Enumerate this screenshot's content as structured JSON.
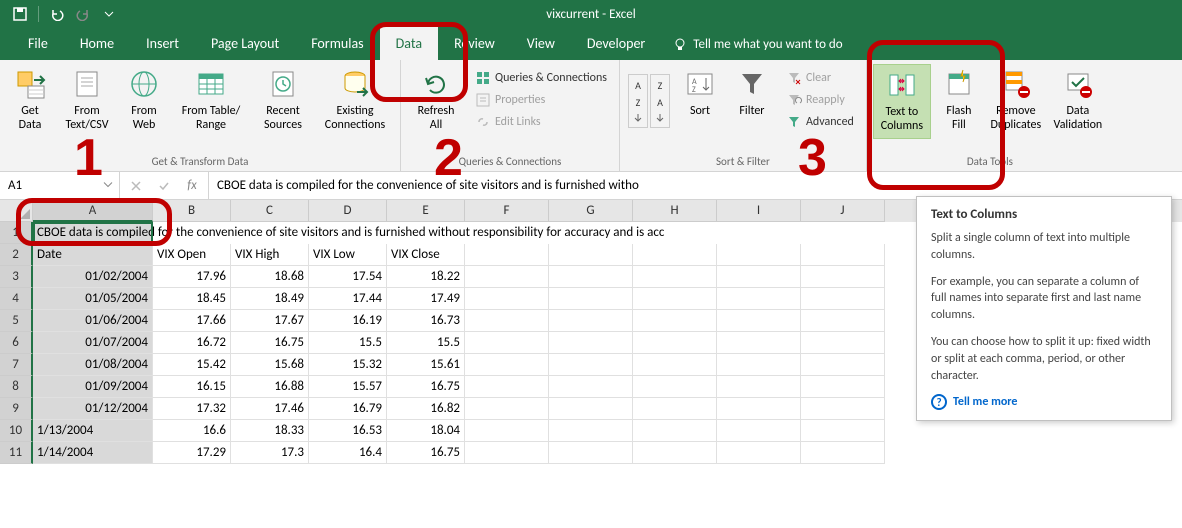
{
  "title": "vixcurrent  -  Excel",
  "tabs": {
    "file": "File",
    "home": "Home",
    "insert": "Insert",
    "page_layout": "Page Layout",
    "formulas": "Formulas",
    "data": "Data",
    "review": "Review",
    "view": "View",
    "developer": "Developer"
  },
  "tellme": "Tell me what you want to do",
  "ribbon": {
    "get_transform": {
      "label": "Get & Transform Data",
      "get_data": "Get\nData",
      "from_text": "From\nText/CSV",
      "from_web": "From\nWeb",
      "from_table": "From Table/\nRange",
      "recent": "Recent\nSources",
      "existing": "Existing\nConnections"
    },
    "queries": {
      "label": "Queries & Connections",
      "refresh": "Refresh\nAll",
      "qc": "Queries & Connections",
      "props": "Properties",
      "edit": "Edit Links"
    },
    "sort_filter": {
      "label": "Sort & Filter",
      "sort": "Sort",
      "filter": "Filter",
      "clear": "Clear",
      "reapply": "Reapply",
      "advanced": "Advanced"
    },
    "data_tools": {
      "label": "Data Tools",
      "text_to_columns": "Text to\nColumns",
      "flash_fill": "Flash\nFill",
      "remove_dup": "Remove\nDuplicates",
      "validation": "Data\nValidation"
    }
  },
  "namebox": "A1",
  "formula": "CBOE data is compiled for the convenience of site visitors and is furnished witho",
  "columns": [
    "A",
    "B",
    "C",
    "D",
    "E",
    "F",
    "G",
    "H",
    "I",
    "J"
  ],
  "row1_overflow": "CBOE data is compiled for the convenience of site visitors and is furnished without responsibility for accuracy and is acc",
  "headers": {
    "date": "Date",
    "open": "VIX Open",
    "high": "VIX High",
    "low": "VIX Low",
    "close": "VIX Close"
  },
  "chart_data": {
    "type": "table",
    "columns": [
      "Date",
      "VIX Open",
      "VIX High",
      "VIX Low",
      "VIX Close"
    ],
    "rows": [
      {
        "date": "01/02/2004",
        "open": 17.96,
        "high": 18.68,
        "low": 17.54,
        "close": 18.22
      },
      {
        "date": "01/05/2004",
        "open": 18.45,
        "high": 18.49,
        "low": 17.44,
        "close": 17.49
      },
      {
        "date": "01/06/2004",
        "open": 17.66,
        "high": 17.67,
        "low": 16.19,
        "close": 16.73
      },
      {
        "date": "01/07/2004",
        "open": 16.72,
        "high": 16.75,
        "low": 15.5,
        "close": 15.5
      },
      {
        "date": "01/08/2004",
        "open": 15.42,
        "high": 15.68,
        "low": 15.32,
        "close": 15.61
      },
      {
        "date": "01/09/2004",
        "open": 16.15,
        "high": 16.88,
        "low": 15.57,
        "close": 16.75
      },
      {
        "date": "01/12/2004",
        "open": 17.32,
        "high": 17.46,
        "low": 16.79,
        "close": 16.82
      },
      {
        "date": "1/13/2004",
        "open": 16.6,
        "high": 18.33,
        "low": 16.53,
        "close": 18.04
      },
      {
        "date": "1/14/2004",
        "open": 17.29,
        "high": 17.3,
        "low": 16.4,
        "close": 16.75
      }
    ]
  },
  "tooltip": {
    "title": "Text to Columns",
    "p1": "Split a single column of text into multiple columns.",
    "p2": "For example, you can separate a column of full names into separate first and last name columns.",
    "p3": "You can choose how to split it up: fixed width or split at each comma, period, or other character.",
    "more": "Tell me more"
  },
  "annotations": {
    "n1": "1",
    "n2": "2",
    "n3": "3"
  }
}
